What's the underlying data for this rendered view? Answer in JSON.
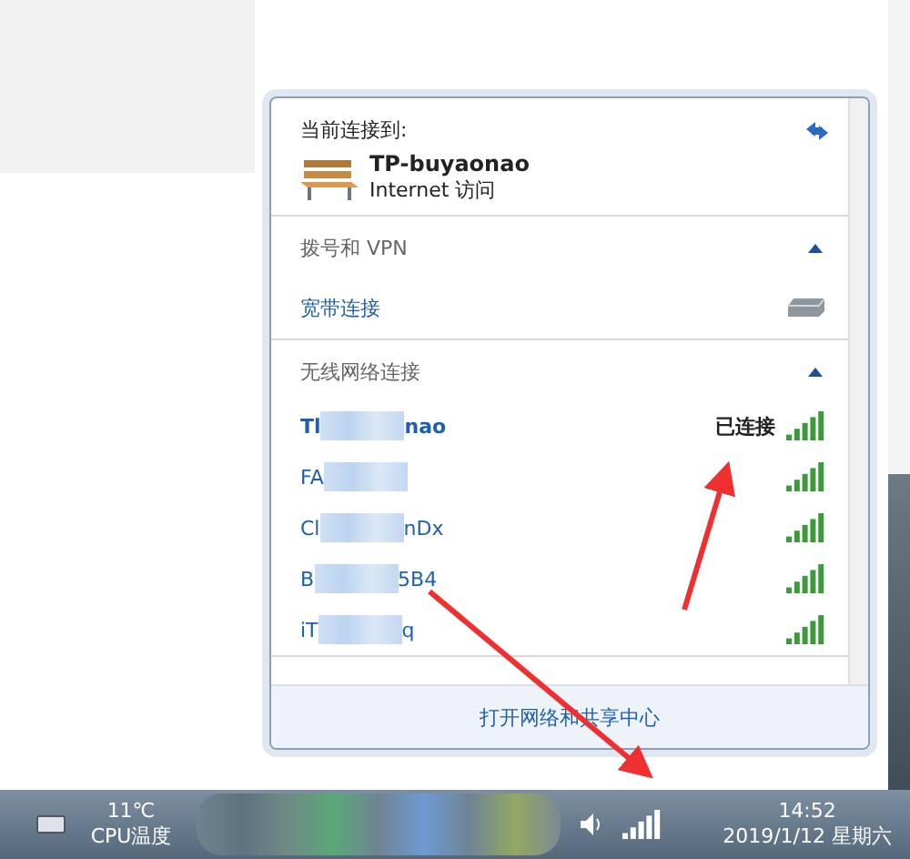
{
  "popup": {
    "current_label": "当前连接到:",
    "connection": {
      "name": "TP-buyaonao",
      "access": "Internet 访问"
    },
    "sections": [
      {
        "title": "拨号和 VPN",
        "expanded": true,
        "items": [
          {
            "kind": "dialup",
            "name_start": "宽带连接"
          }
        ]
      },
      {
        "title": "无线网络连接",
        "expanded": true,
        "items": [
          {
            "kind": "wifi",
            "name_start": "Tl",
            "name_end": "nao",
            "status": "已连接",
            "connected": true
          },
          {
            "kind": "wifi",
            "name_start": "FA",
            "connected": false
          },
          {
            "kind": "wifi",
            "name_start": "Cl",
            "name_end": "nDx",
            "connected": false
          },
          {
            "kind": "wifi",
            "name_start": "B",
            "name_end": "5B4",
            "connected": false
          },
          {
            "kind": "wifi",
            "name_start": "iT",
            "name_end": "q",
            "connected": false
          }
        ]
      }
    ],
    "footer_link": "打开网络和共享中心"
  },
  "taskbar": {
    "temperature": "11℃",
    "temperature_label": "CPU温度",
    "time": "14:52",
    "date": "2019/1/12 星期六"
  }
}
